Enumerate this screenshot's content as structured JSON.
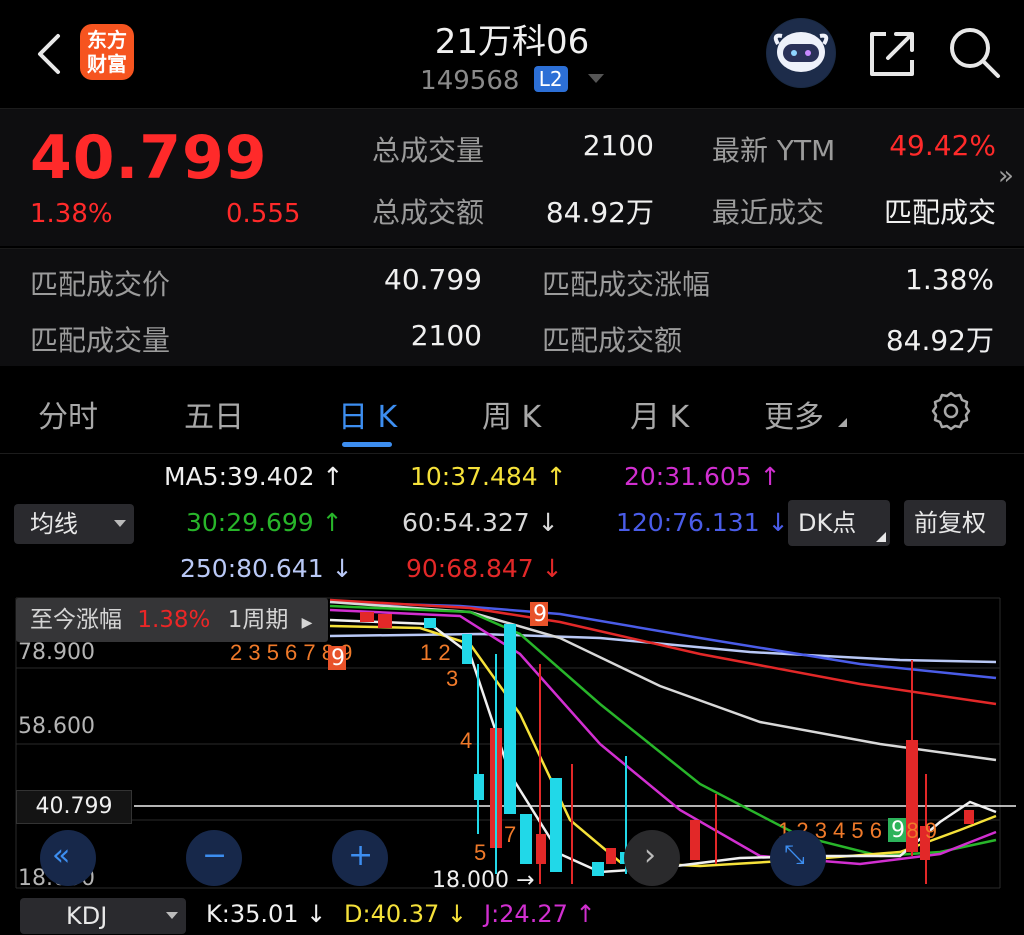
{
  "header": {
    "logo_line1": "东方",
    "logo_line2": "财富",
    "title": "21万科06",
    "code": "149568",
    "level_badge": "L2"
  },
  "quote": {
    "price": "40.799",
    "change_pct": "1.38%",
    "change": "0.555",
    "total_volume_label": "总成交量",
    "total_volume": "2100",
    "total_amount_label": "总成交额",
    "total_amount": "84.92万",
    "ytm_label": "最新 YTM",
    "ytm": "49.42%",
    "recent_trade_label": "最近成交",
    "recent_trade": "匹配成交",
    "more_glyph": "»"
  },
  "match": {
    "price_label": "匹配成交价",
    "price": "40.799",
    "pct_label": "匹配成交涨幅",
    "pct": "1.38%",
    "volume_label": "匹配成交量",
    "volume": "2100",
    "amount_label": "匹配成交额",
    "amount": "84.92万"
  },
  "tabs": [
    {
      "label": "分时"
    },
    {
      "label": "五日"
    },
    {
      "label": "日 K"
    },
    {
      "label": "周 K"
    },
    {
      "label": "月 K"
    },
    {
      "label": "更多"
    }
  ],
  "indicators": {
    "ma_select": "均线",
    "ma5": "MA5:39.402 ↑",
    "ma10": "10:37.484 ↑",
    "ma20": "20:31.605 ↑",
    "ma30": "30:29.699 ↑",
    "ma60": "60:54.327 ↓",
    "ma120": "120:76.131 ↓",
    "ma250": "250:80.641 ↓",
    "ma90": "90:68.847 ↓",
    "dk_button": "DK点",
    "restore_button": "前复权",
    "colors": {
      "ma5": "#f0f0f0",
      "ma10": "#f5e13a",
      "ma20": "#d12fd0",
      "ma30": "#28b52a",
      "ma60": "#d8d8d8",
      "ma120": "#4a5ce8",
      "ma250": "#b9c8f5",
      "ma90": "#e22828"
    }
  },
  "chart": {
    "since_label": "至今涨幅",
    "since_value": "1.38%",
    "period_label": "1周期",
    "y_labels": [
      "78.900",
      "58.600",
      "18.000"
    ],
    "current_price_tag": "40.799",
    "low_marker": "18.000",
    "seq_top_left": "2 3 5 6 7 8 9",
    "seq_mid": "1 2",
    "seq_right": "1 2 3 4 5 6 7 8 9"
  },
  "chart_data": {
    "type": "candlestick",
    "title": "",
    "series_lines": [
      "MA5",
      "10",
      "20",
      "30",
      "60",
      "120",
      "250",
      "90"
    ],
    "marked_levels": [
      78.9,
      58.6,
      40.799,
      18.0
    ],
    "current_price": 40.799,
    "visible_low": 18.0
  },
  "kdj": {
    "select": "KDJ",
    "k": "K:35.01 ↓",
    "d": "D:40.37 ↓",
    "j": "J:24.27 ↑",
    "colors": {
      "k": "#f0f0f0",
      "d": "#f5e13a",
      "j": "#d12fd0"
    }
  }
}
